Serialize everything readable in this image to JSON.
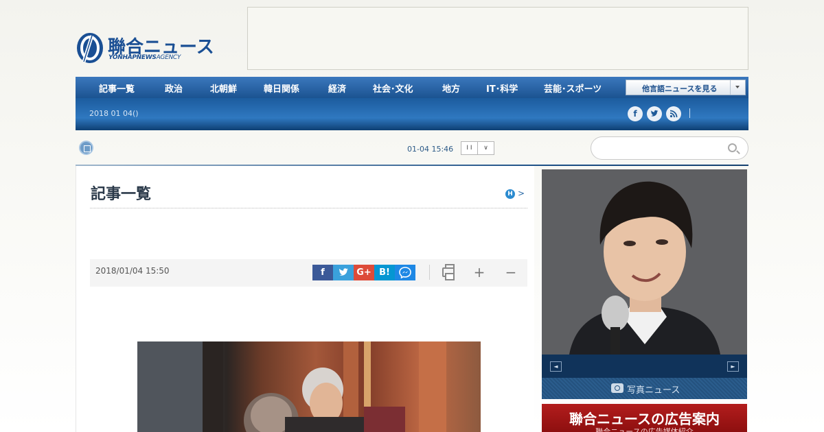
{
  "logo": {
    "title": "聯合ニュース",
    "sub_bold": "YONHAPNEWS",
    "sub_light": "AGENCY"
  },
  "nav": {
    "items": [
      "記事一覧",
      "政治",
      "北朝鮮",
      "韓日関係",
      "経済",
      "社会･文化",
      "地方",
      "IT･科学",
      "芸能･スポーツ"
    ],
    "language_select": "他言語ニュースを見る",
    "date": "2018 01 04()",
    "social": [
      "f",
      "t",
      "rss"
    ]
  },
  "ticker": {
    "time": "01-04 15:46",
    "pause_label": "I I",
    "toggle_label": "∨"
  },
  "search": {
    "placeholder": ""
  },
  "section": {
    "title": "記事一覧",
    "home_badge": "H",
    "home_arrow": ">"
  },
  "article": {
    "date": "2018/01/04 15:50",
    "share": [
      "f",
      "t",
      "G+",
      "B!",
      "m"
    ],
    "tools": {
      "plus": "+",
      "minus": "−"
    }
  },
  "sidebar": {
    "prev": "◄",
    "next": "►",
    "photo_news_label": "写真ニュース",
    "ad_title": "聯合ニュースの広告案内",
    "ad_sub": "聯合ニュースの広告媒体紹介"
  },
  "colors": {
    "brand_blue": "#1a4f94",
    "facebook": "#3b5998",
    "twitter": "#3aa1dc",
    "google_plus": "#dd4b39",
    "hatena": "#0596d2",
    "messenger": "#1e88e5",
    "ad_red": "#b31d1d"
  }
}
